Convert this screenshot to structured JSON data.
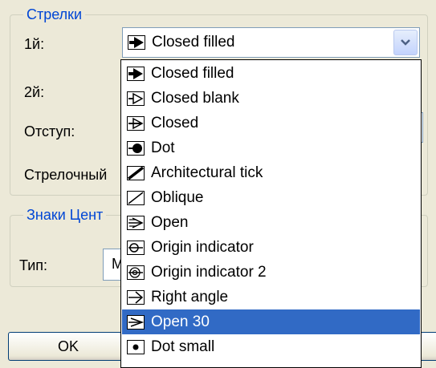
{
  "arrows_group": {
    "title": "Стрелки",
    "first_label": "1й:",
    "second_label": "2й:",
    "offset_label": "Отступ:",
    "arrow_label": "Стрелочный"
  },
  "first_combo": {
    "value": "Closed filled",
    "value_icon": "closed-filled-arrow-icon"
  },
  "center_group": {
    "title": "Знаки Цент",
    "type_label": "Тип:",
    "type_value": "М"
  },
  "dropdown": {
    "items": [
      {
        "label": "Closed filled",
        "icon": "closed-filled-arrow-icon"
      },
      {
        "label": "Closed blank",
        "icon": "closed-blank-arrow-icon"
      },
      {
        "label": "Closed",
        "icon": "closed-arrow-icon"
      },
      {
        "label": "Dot",
        "icon": "dot-arrow-icon"
      },
      {
        "label": "Architectural tick",
        "icon": "architectural-tick-icon"
      },
      {
        "label": "Oblique",
        "icon": "oblique-icon"
      },
      {
        "label": "Open",
        "icon": "open-arrow-icon"
      },
      {
        "label": "Origin indicator",
        "icon": "origin-indicator-icon"
      },
      {
        "label": "Origin indicator 2",
        "icon": "origin-indicator-2-icon"
      },
      {
        "label": "Right angle",
        "icon": "right-angle-arrow-icon"
      },
      {
        "label": "Open 30",
        "icon": "open-30-arrow-icon"
      },
      {
        "label": "Dot small",
        "icon": "dot-small-arrow-icon"
      }
    ],
    "selected_label": "Open 30",
    "highlight_color": "#316ac5"
  },
  "buttons": {
    "ok_label": "OK"
  }
}
